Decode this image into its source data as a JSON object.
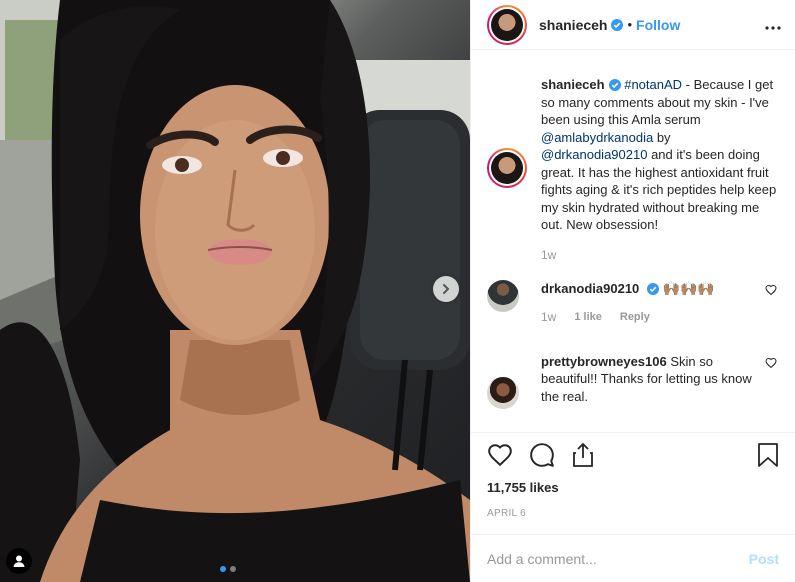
{
  "photo": {
    "alt": "",
    "carousel_dot_count": 2,
    "carousel_active_index": 0,
    "next_icon": "chevron-right-icon",
    "tag_icon": "user-tag-icon"
  },
  "header": {
    "username": "shanieceh",
    "separator": "•",
    "follow_label": "Follow",
    "more_label": "•••",
    "verified_icon": "verified-badge-icon"
  },
  "caption": {
    "username": "shanieceh",
    "hashtag": "#notanAD",
    "text_1": " - Because I get so many comments about my skin - I've been using this Amla serum ",
    "mention_1": "@amlabydrkanodia",
    "text_2": " by ",
    "mention_2": "@drkanodia90210",
    "text_3": " and it's been doing great. It has the highest antioxidant fruit fights aging & it's rich peptides help keep my skin hydrated without breaking me out. New obsession!",
    "time": "1w"
  },
  "comments": [
    {
      "username": "drkanodia90210",
      "text": "🙌🏽🙌🏽🙌🏽",
      "time": "1w",
      "likes": "1 like",
      "reply": "Reply"
    },
    {
      "username": "prettybrowneyes106",
      "text": "Skin so beautiful!! Thanks for letting us know the real."
    }
  ],
  "actions": {
    "like_icon": "heart-icon",
    "comment_icon": "comment-icon",
    "share_icon": "share-icon",
    "save_icon": "bookmark-icon"
  },
  "likes": "11,755 likes",
  "date": "APRIL 6",
  "add_comment": {
    "placeholder": "Add a comment...",
    "post_label": "Post"
  },
  "colors": {
    "accent": "#3897f0",
    "text": "#262626",
    "muted": "#999999",
    "post_disabled": "#b2dffc"
  }
}
